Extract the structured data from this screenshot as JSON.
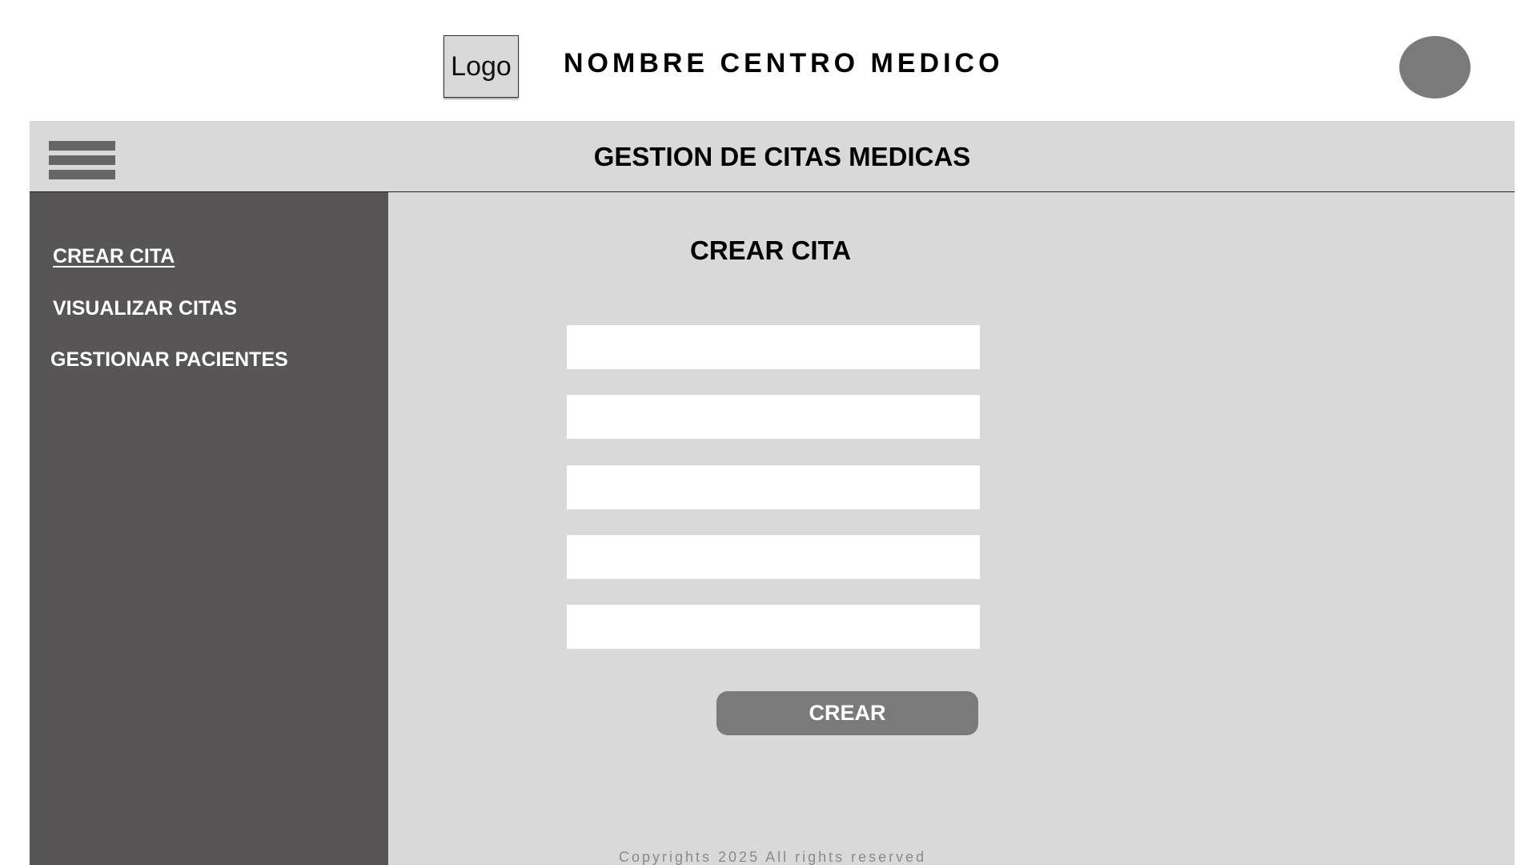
{
  "header": {
    "logo_text": "Logo",
    "center_name": "NOMBRE CENTRO MEDICO",
    "avatar_icon": "user-avatar"
  },
  "titlebar": {
    "menu_icon": "hamburger-menu-icon",
    "title": "GESTION DE CITAS MEDICAS"
  },
  "sidebar": {
    "items": [
      {
        "label": "CREAR CITA",
        "active": true
      },
      {
        "label": "VISUALIZAR CITAS",
        "active": false
      },
      {
        "label": "GESTIONAR PACIENTES",
        "active": false
      }
    ]
  },
  "main": {
    "form_title": "CREAR CITA",
    "fields": [
      {
        "value": "",
        "placeholder": ""
      },
      {
        "value": "",
        "placeholder": ""
      },
      {
        "value": "",
        "placeholder": ""
      },
      {
        "value": "",
        "placeholder": ""
      },
      {
        "value": "",
        "placeholder": ""
      }
    ],
    "submit_label": "CREAR",
    "footer": "Copyrights 2025 All rights reserved"
  },
  "colors": {
    "sidebar_bg": "#575556",
    "panel_bg": "#d9d9d9",
    "button_bg": "#7a7a7a",
    "avatar_bg": "#7a7a7a"
  }
}
